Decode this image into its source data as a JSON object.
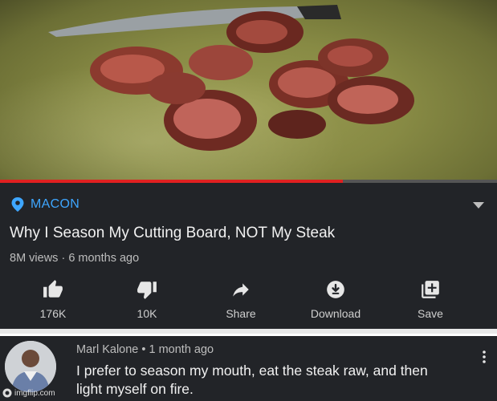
{
  "video": {
    "watch_progress_percent": 69
  },
  "channel": {
    "location_label": "MACON"
  },
  "video_info": {
    "title": "Why I Season My Cutting Board, NOT My Steak",
    "meta": "8M views · 6 months ago"
  },
  "actions": [
    {
      "label": "176K",
      "icon": "thumbs-up-icon"
    },
    {
      "label": "10K",
      "icon": "thumbs-down-icon"
    },
    {
      "label": "Share",
      "icon": "share-icon"
    },
    {
      "label": "Download",
      "icon": "download-icon"
    },
    {
      "label": "Save",
      "icon": "save-playlist-icon"
    }
  ],
  "comment": {
    "header": "Marl Kalone • 1 month ago",
    "text": "I prefer to season my mouth, eat the steak raw, and then light myself on fire."
  },
  "watermark": {
    "text": "imgflip.com"
  },
  "colors": {
    "background": "#222428",
    "location_blue": "#3ea6ff",
    "progress_red": "#e02020"
  }
}
